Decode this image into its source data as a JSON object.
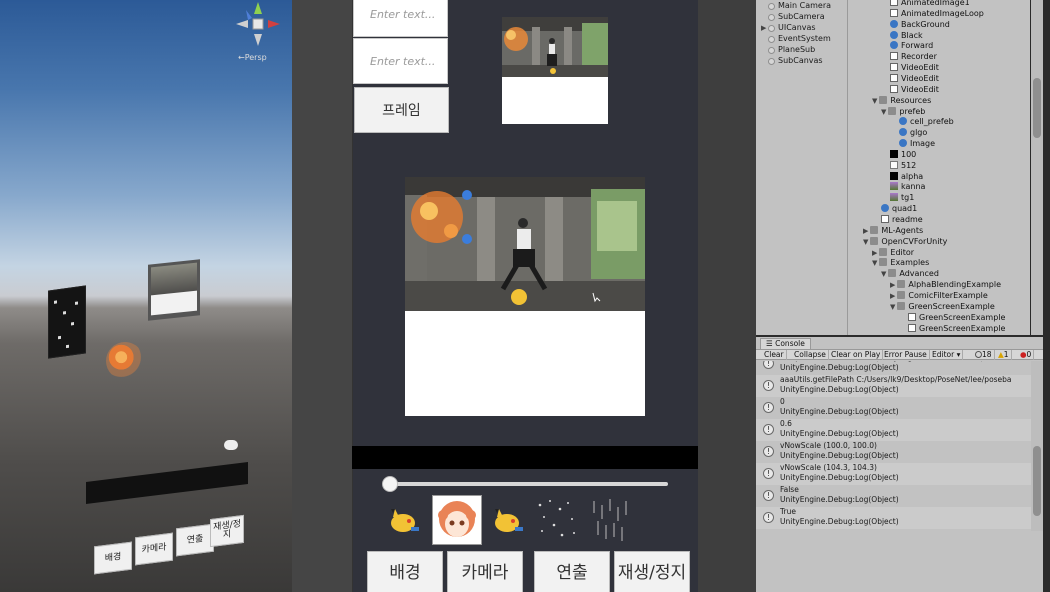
{
  "scene": {
    "persp_label": "←Persp",
    "buttons": [
      "배경",
      "카메라",
      "연출",
      "재생/정지"
    ]
  },
  "game": {
    "input1_placeholder": "Enter text...",
    "input2_placeholder": "Enter text...",
    "frame_button": "프레임",
    "slider_value": 0,
    "bottom_buttons": {
      "background": "배경",
      "camera": "카메라",
      "direction": "연출",
      "play_stop": "재생/정지"
    },
    "icons": [
      "pikachu-sticker-icon",
      "anime-girl-sticker-icon",
      "pikachu-sticker-icon",
      "sparkle-effect-icon",
      "rain-effect-icon"
    ]
  },
  "hierarchy": {
    "items": [
      "Main Camera",
      "SubCamera",
      "UICanvas",
      "EventSystem",
      "PlaneSub",
      "SubCanvas"
    ]
  },
  "project": {
    "items": [
      {
        "label": "AnimatedImage1",
        "icon": "script",
        "indent": 0
      },
      {
        "label": "AnimatedImageLoop",
        "icon": "script",
        "indent": 0
      },
      {
        "label": "BackGround",
        "icon": "ball",
        "indent": 0
      },
      {
        "label": "Black",
        "icon": "ball",
        "indent": 0
      },
      {
        "label": "Forward",
        "icon": "ball",
        "indent": 0
      },
      {
        "label": "Recorder",
        "icon": "script",
        "indent": 0
      },
      {
        "label": "VideoEdit",
        "icon": "script",
        "indent": 0
      },
      {
        "label": "VideoEdit",
        "icon": "script",
        "indent": 0
      },
      {
        "label": "VideoEdit",
        "icon": "script",
        "indent": 0
      },
      {
        "label": "Resources",
        "icon": "folder",
        "indent": -1,
        "arrow": "▼"
      },
      {
        "label": "prefeb",
        "icon": "folder",
        "indent": 0,
        "arrow": "▼"
      },
      {
        "label": "cell_prefeb",
        "icon": "ball",
        "indent": 1
      },
      {
        "label": "glgo",
        "icon": "ball",
        "indent": 1
      },
      {
        "label": "Image",
        "icon": "ball",
        "indent": 1
      },
      {
        "label": "100",
        "icon": "black",
        "indent": 0
      },
      {
        "label": "512",
        "icon": "white",
        "indent": 0
      },
      {
        "label": "alpha",
        "icon": "black",
        "indent": 0
      },
      {
        "label": "kanna",
        "icon": "img",
        "indent": 0
      },
      {
        "label": "tg1",
        "icon": "img",
        "indent": 0
      },
      {
        "label": "quad1",
        "icon": "ball",
        "indent": -1
      },
      {
        "label": "readme",
        "icon": "script",
        "indent": -1
      },
      {
        "label": "ML-Agents",
        "icon": "folder",
        "indent": -2,
        "arrow": "▶"
      },
      {
        "label": "OpenCVForUnity",
        "icon": "folder",
        "indent": -2,
        "arrow": "▼"
      },
      {
        "label": "Editor",
        "icon": "folder",
        "indent": -1,
        "arrow": "▶"
      },
      {
        "label": "Examples",
        "icon": "folder",
        "indent": -1,
        "arrow": "▼"
      },
      {
        "label": "Advanced",
        "icon": "folder",
        "indent": 0,
        "arrow": "▼"
      },
      {
        "label": "AlphaBlendingExample",
        "icon": "folder",
        "indent": 1,
        "arrow": "▶"
      },
      {
        "label": "ComicFilterExample",
        "icon": "folder",
        "indent": 1,
        "arrow": "▶"
      },
      {
        "label": "GreenScreenExample",
        "icon": "folder",
        "indent": 1,
        "arrow": "▼"
      },
      {
        "label": "GreenScreenExample",
        "icon": "script",
        "indent": 2
      },
      {
        "label": "GreenScreenExample",
        "icon": "script",
        "indent": 2
      }
    ]
  },
  "console": {
    "tab_label": "Console",
    "toolbar": {
      "clear": "Clear",
      "collapse": "Collapse",
      "clear_on_play": "Clear on Play",
      "error_pause": "Error Pause",
      "editor": "Editor",
      "log_count": "18",
      "warn_count": "1",
      "error_count": "0"
    },
    "entries": [
      {
        "line1": "Temposer 1903 640x360 (UnityEngine.RenderTexture)",
        "line2": "UnityEngine.Debug:Log(Object)"
      },
      {
        "line1": "aaaUtils.getFilePath  C:/Users/lk9/Desktop/PoseNet/lee/poseba",
        "line2": "UnityEngine.Debug:Log(Object)"
      },
      {
        "line1": "0",
        "line2": "UnityEngine.Debug:Log(Object)"
      },
      {
        "line1": "0.6",
        "line2": "UnityEngine.Debug:Log(Object)"
      },
      {
        "line1": "vNowScale  (100.0, 100.0)",
        "line2": "UnityEngine.Debug:Log(Object)"
      },
      {
        "line1": "vNowScale  (104.3, 104.3)",
        "line2": "UnityEngine.Debug:Log(Object)"
      },
      {
        "line1": "False",
        "line2": "UnityEngine.Debug:Log(Object)"
      },
      {
        "line1": "True",
        "line2": "UnityEngine.Debug:Log(Object)"
      }
    ]
  }
}
